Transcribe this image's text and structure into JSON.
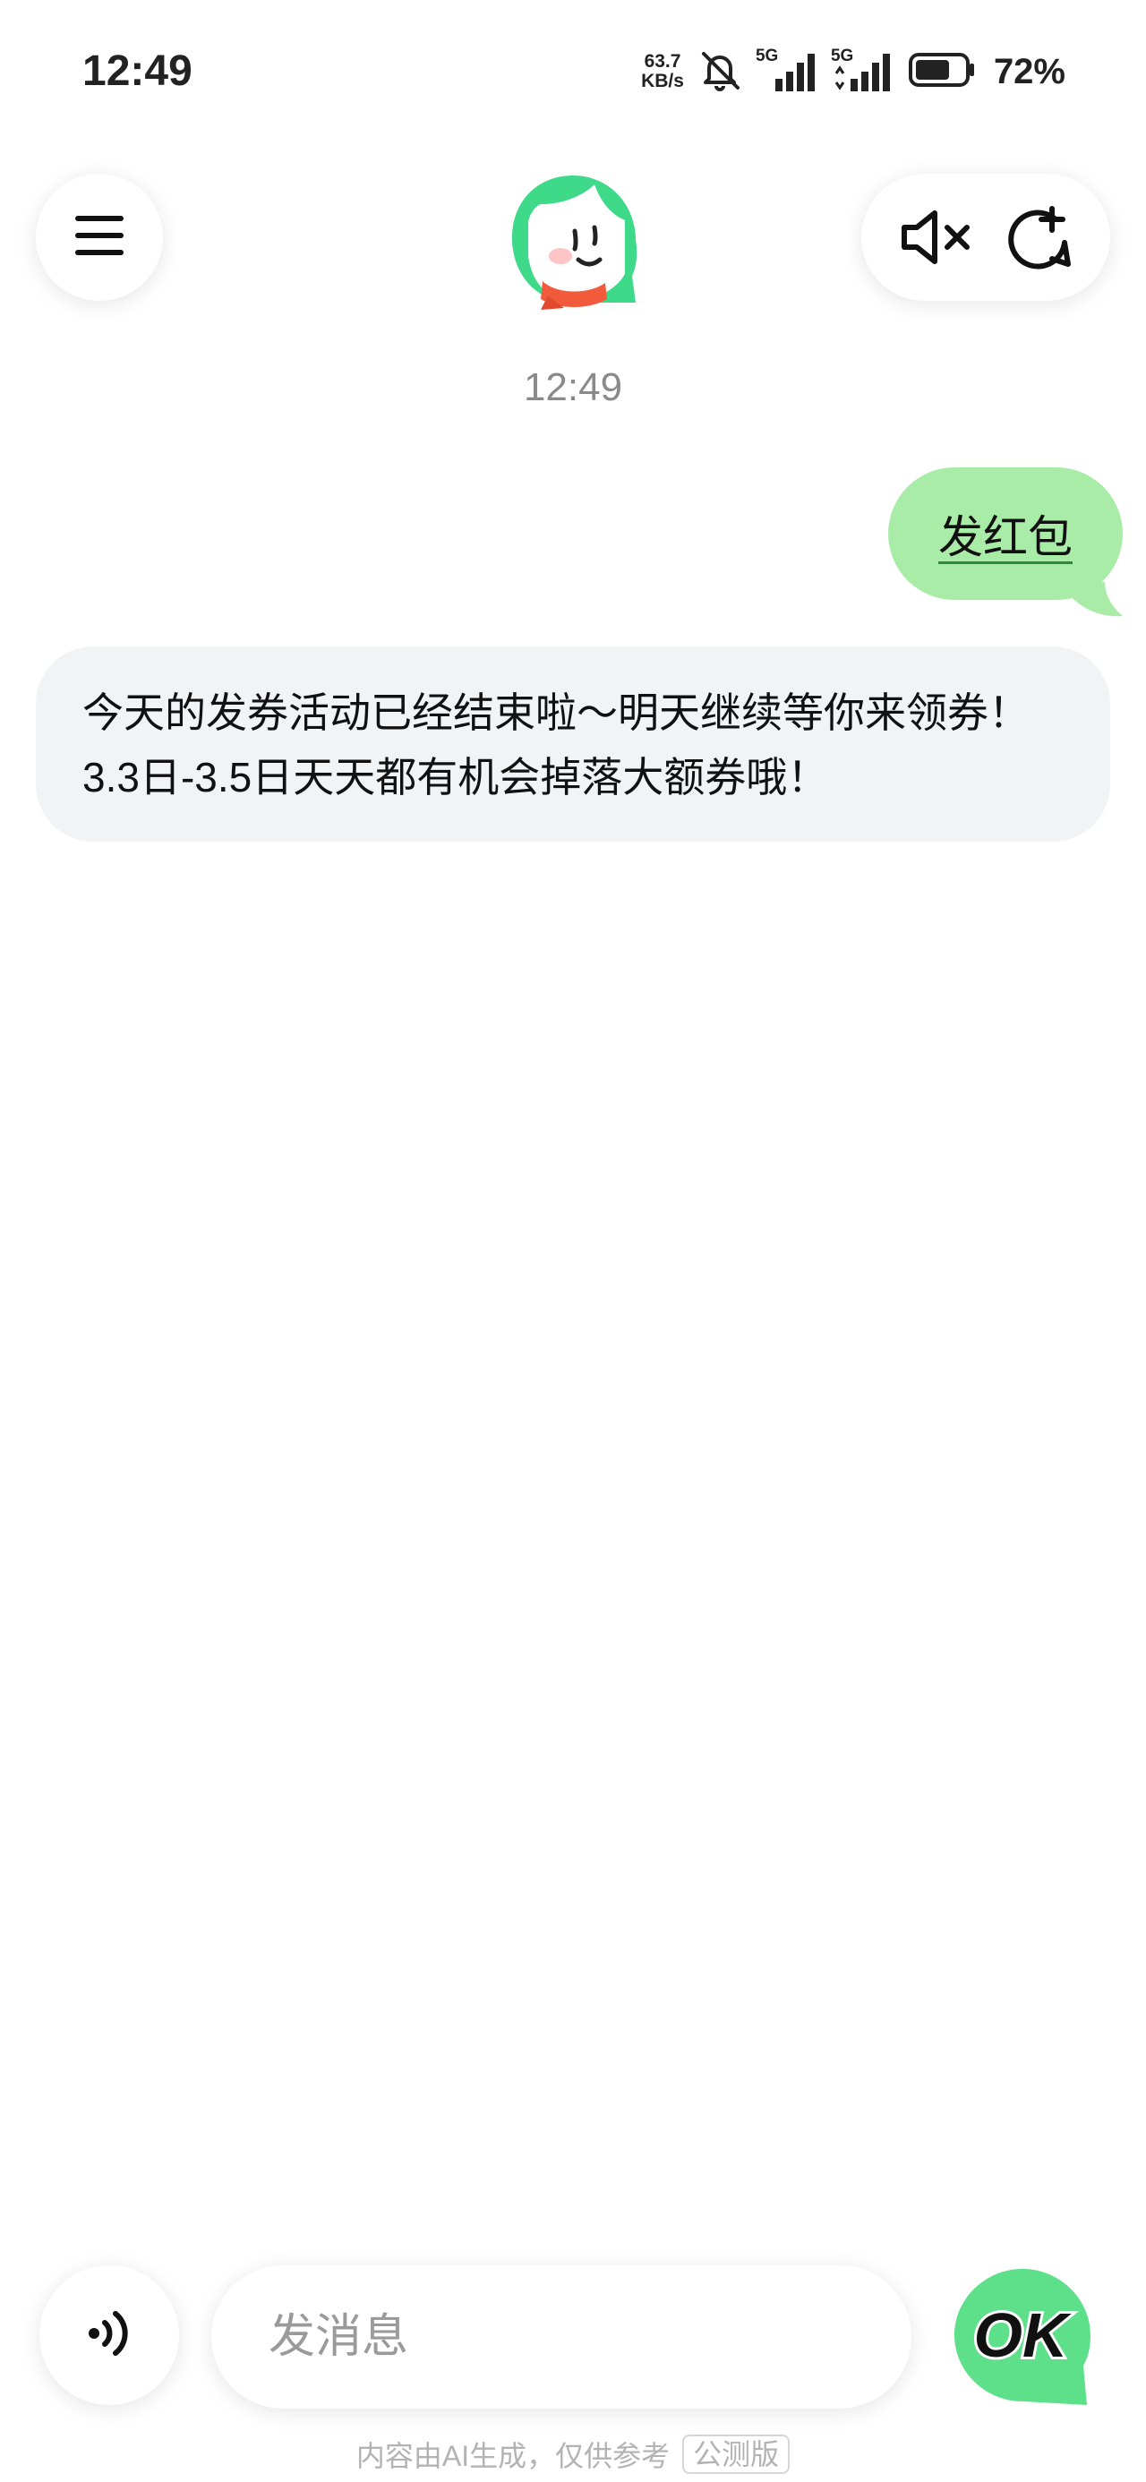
{
  "status_bar": {
    "time": "12:49",
    "net_speed_value": "63.7",
    "net_speed_unit": "KB/s",
    "signal1_tag": "5G",
    "signal2_tag": "5G",
    "battery_percent": "72%",
    "battery_level": 0.72
  },
  "header": {
    "menu_icon": "hamburger-menu-icon",
    "avatar": "assistant-avatar",
    "mute_icon": "speaker-muted-icon",
    "new_chat_icon": "new-chat-icon"
  },
  "chat": {
    "timestamp": "12:49",
    "messages": [
      {
        "role": "user",
        "text": "发红包"
      },
      {
        "role": "assistant",
        "text": "今天的发券活动已经结束啦～明天继续等你来领券！3.3日-3.5日天天都有机会掉落大额券哦！"
      }
    ]
  },
  "input_bar": {
    "voice_icon": "voice-input-icon",
    "placeholder": "发消息",
    "value": "",
    "ok_label": "OK"
  },
  "footer": {
    "note": "内容由AI生成，仅供参考",
    "badge": "公测版"
  },
  "colors": {
    "user_bubble": "#a8eca8",
    "bot_bubble": "#f2f3f4",
    "accent_green": "#5ee08a"
  }
}
